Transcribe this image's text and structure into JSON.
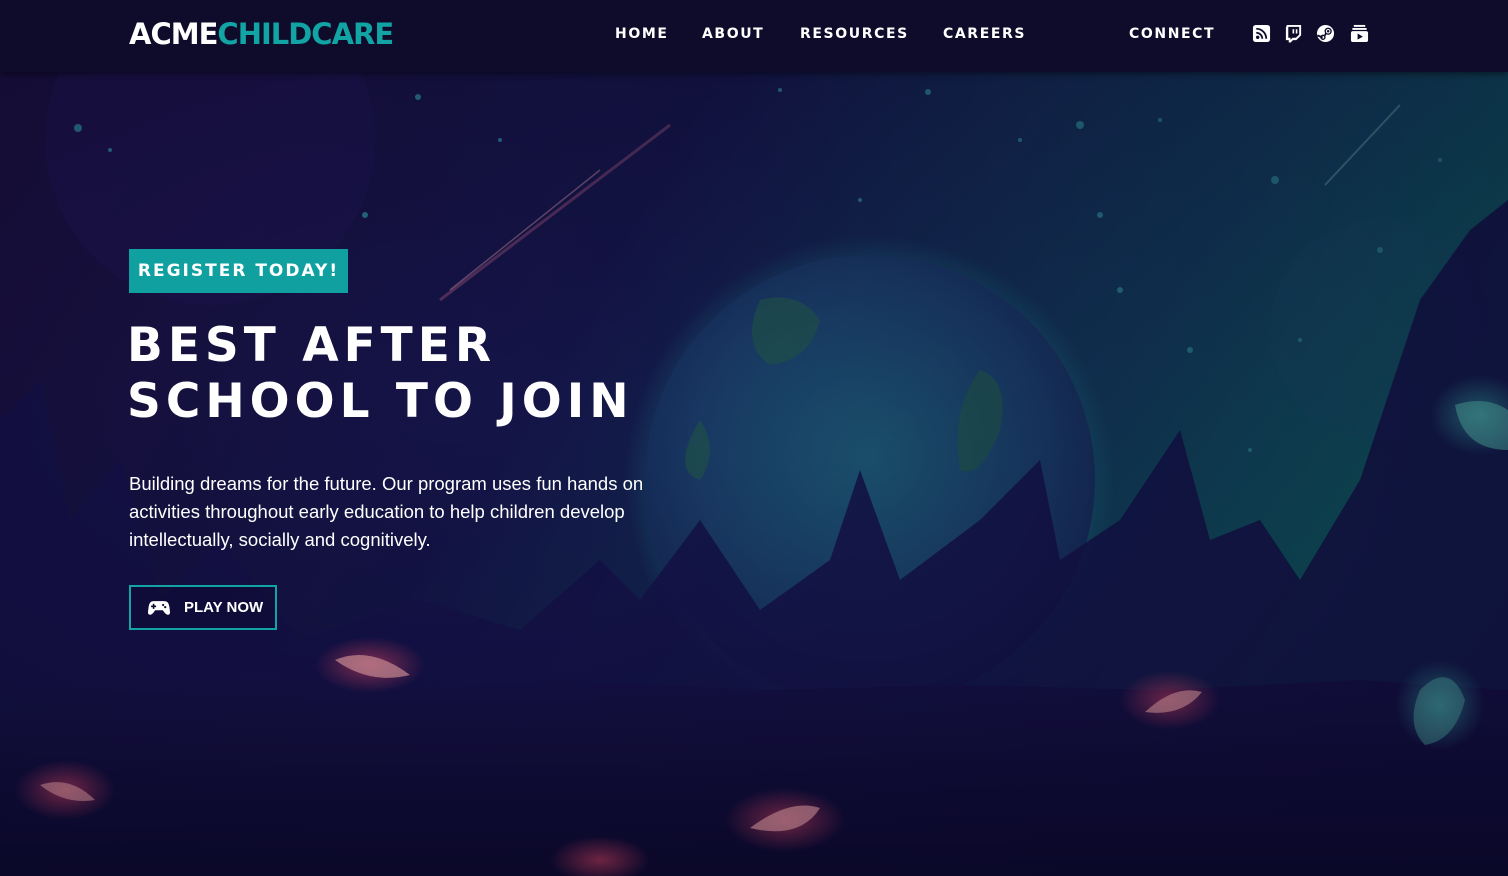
{
  "header": {
    "logo": {
      "part1": "ACME",
      "part2": "CHILDCARE"
    },
    "nav": [
      {
        "label": "HOME"
      },
      {
        "label": "ABOUT"
      },
      {
        "label": "RESOURCES"
      },
      {
        "label": "CAREERS"
      },
      {
        "label": "CONNECT"
      }
    ],
    "social_icons": [
      "rss-icon",
      "twitch-icon",
      "steam-icon",
      "youtube-icon"
    ]
  },
  "hero": {
    "badge_label": "REGISTER TODAY!",
    "title_line1": "BEST AFTER",
    "title_line2": "SCHOOL TO JOIN",
    "description": "Building dreams for the future. Our program uses fun hands on activities throughout early education to help children develop intellectually, socially and cognitively.",
    "cta_label": "PLAY NOW",
    "cta_icon": "gamepad-icon"
  },
  "colors": {
    "accent": "#12a4a4",
    "header_bg": "#0f0c2b",
    "page_bg": "#0e0a2e",
    "text": "#ffffff"
  }
}
